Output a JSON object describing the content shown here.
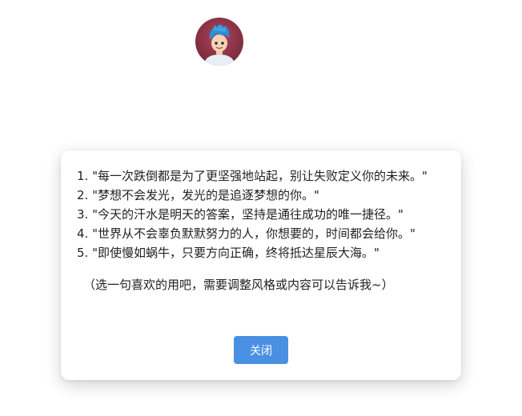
{
  "avatar": {
    "alt": "avatar"
  },
  "dialog": {
    "quotes": [
      "1. \"每一次跌倒都是为了更坚强地站起，别让失败定义你的未来。\"",
      "2. \"梦想不会发光，发光的是追逐梦想的你。\"",
      "3. \"今天的汗水是明天的答案，坚持是通往成功的唯一捷径。\"",
      "4. \"世界从不会辜负默默努力的人，你想要的，时间都会给你。\"",
      "5. \"即使慢如蜗牛，只要方向正确，终将抵达星辰大海。\""
    ],
    "note": "（选一句喜欢的用吧，需要调整风格或内容可以告诉我~）",
    "close_label": "关闭"
  },
  "colors": {
    "button": "#4a90e2",
    "avatar_bg": "#7c2d3f"
  }
}
